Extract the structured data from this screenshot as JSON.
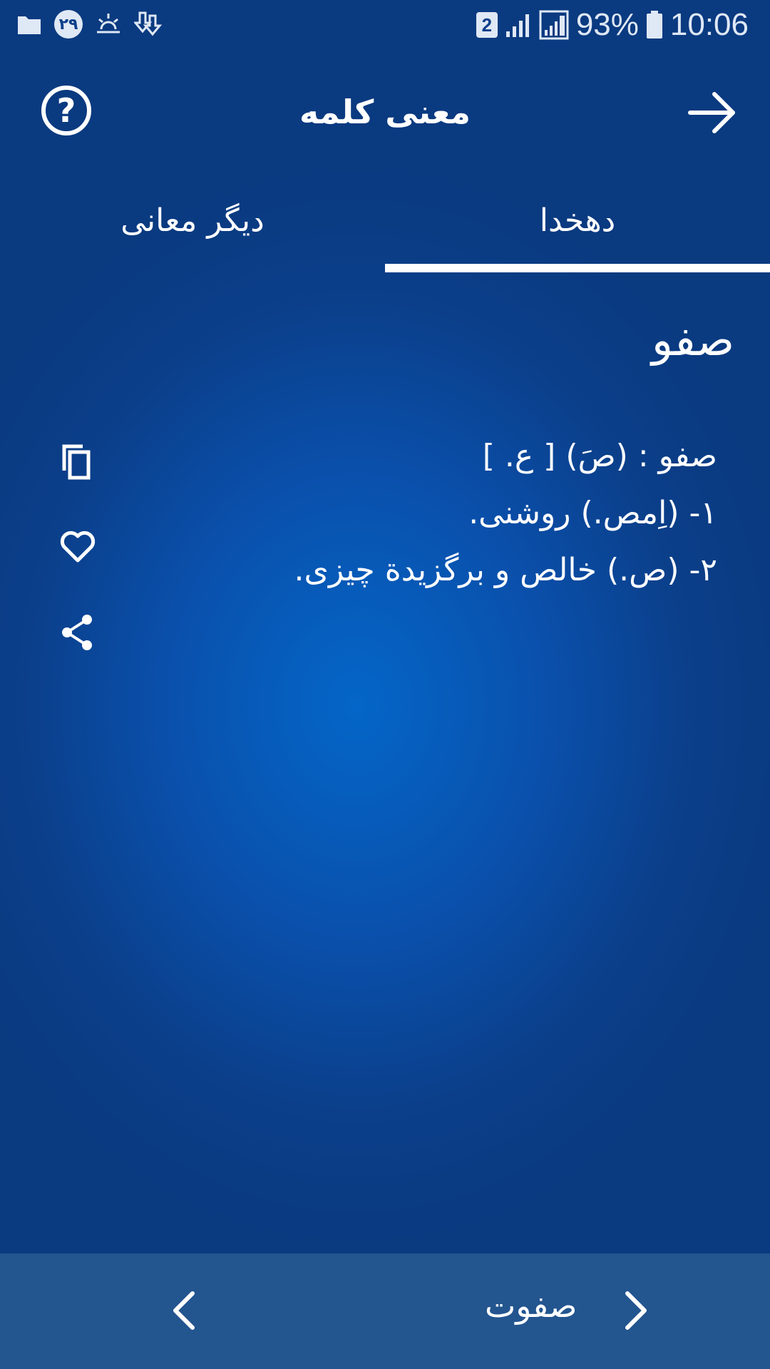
{
  "status_bar": {
    "notification_count": "۲۹",
    "sim_slot": "2",
    "battery": "93%",
    "time": "10:06"
  },
  "app_bar": {
    "title": "معنی کلمه"
  },
  "tabs": [
    {
      "label": "دیگر معانی",
      "selected": false
    },
    {
      "label": "دهخدا",
      "selected": true
    }
  ],
  "entry": {
    "headword": "صفو",
    "definition_lines": [
      "صفو : (صَ) [ ع. ]",
      "۱- (اِمص.) روشنی.",
      "۲- (ص.) خالص و برگزیدة چیزی."
    ]
  },
  "bottom_nav": {
    "next_word": "صفوت"
  },
  "colors": {
    "background_center": "#0466c8",
    "background_edge": "#0a3a80",
    "bottom_bar": "#23558f",
    "text": "#ffffff"
  }
}
